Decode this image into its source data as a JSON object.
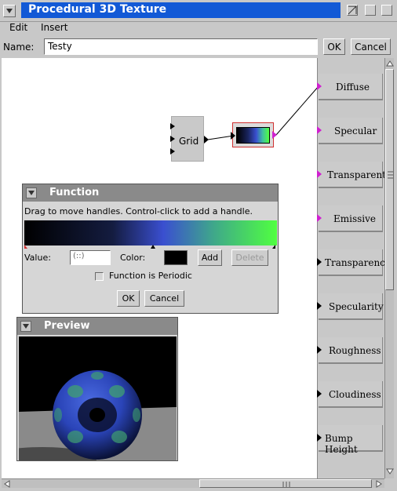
{
  "window": {
    "title": "Procedural 3D Texture"
  },
  "menu": {
    "items": [
      "Edit",
      "Insert"
    ]
  },
  "name_row": {
    "label": "Name:",
    "value": "Testy",
    "ok": "OK",
    "cancel": "Cancel"
  },
  "graph": {
    "grid_node_label": "Grid"
  },
  "ports": [
    {
      "label": "Diffuse",
      "color": "#d020d0"
    },
    {
      "label": "Specular",
      "color": "#d020d0"
    },
    {
      "label": "Transparent",
      "color": "#d020d0"
    },
    {
      "label": "Emissive",
      "color": "#d020d0"
    },
    {
      "label": "Transparency",
      "color": "#000000"
    },
    {
      "label": "Specularity",
      "color": "#000000"
    },
    {
      "label": "Roughness",
      "color": "#000000"
    },
    {
      "label": "Cloudiness",
      "color": "#000000"
    },
    {
      "label": "Bump Height",
      "color": "#000000"
    }
  ],
  "function_panel": {
    "title": "Function",
    "instructions": "Drag to move handles.  Control-click to add a handle.",
    "value_label": "Value:",
    "value_placeholder": "(::)",
    "color_label": "Color:",
    "add": "Add",
    "delete": "Delete",
    "periodic_label": "Function is Periodic",
    "ok": "OK",
    "cancel": "Cancel"
  },
  "preview_panel": {
    "title": "Preview"
  }
}
